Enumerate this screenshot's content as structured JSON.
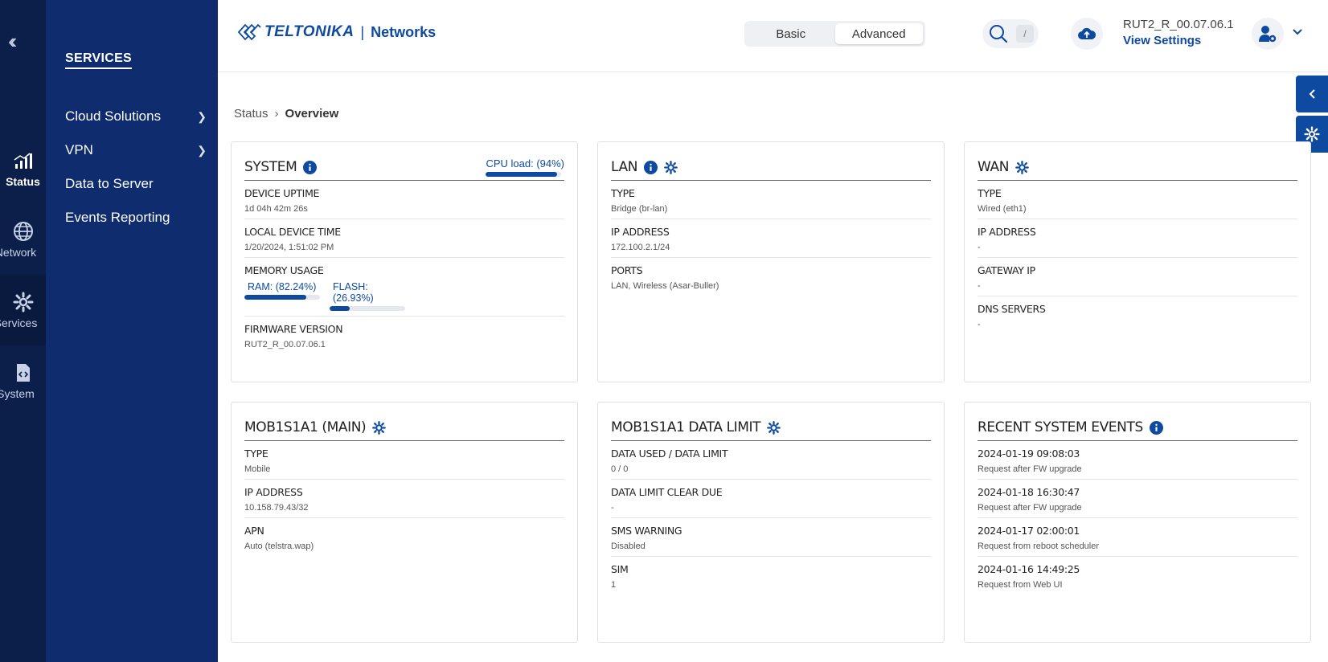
{
  "rail": {
    "items": [
      {
        "label": "Status",
        "icon": "signal-bars-icon"
      },
      {
        "label": "Network",
        "icon": "globe-icon"
      },
      {
        "label": "Services",
        "icon": "gear-icon"
      },
      {
        "label": "System",
        "icon": "file-code-icon"
      }
    ]
  },
  "subnav": {
    "title": "SERVICES",
    "items": [
      {
        "label": "Cloud Solutions",
        "has_children": true
      },
      {
        "label": "VPN",
        "has_children": true
      },
      {
        "label": "Data to Server",
        "has_children": false
      },
      {
        "label": "Events Reporting",
        "has_children": false
      }
    ]
  },
  "header": {
    "brand": "TELTONIKA",
    "brand_suffix": "Networks",
    "mode_basic": "Basic",
    "mode_advanced": "Advanced",
    "mode_selected": "Advanced",
    "search_shortcut": "/",
    "firmware": "RUT2_R_00.07.06.1",
    "view_settings": "View Settings"
  },
  "breadcrumb": {
    "parent": "Status",
    "current": "Overview"
  },
  "cards": {
    "system": {
      "title": "SYSTEM",
      "cpu_label": "CPU load: (94%)",
      "cpu_value": 0.94,
      "uptime_label": "DEVICE UPTIME",
      "uptime_value": "1d 04h 42m 26s",
      "time_label": "LOCAL DEVICE TIME",
      "time_value": "1/20/2024, 1:51:02 PM",
      "memory_label": "MEMORY USAGE",
      "ram_label": "RAM: (82.24%)",
      "ram_value": 0.8224,
      "flash_label": "FLASH: (26.93%)",
      "flash_value": 0.2693,
      "fw_label": "FIRMWARE VERSION",
      "fw_value": "RUT2_R_00.07.06.1"
    },
    "lan": {
      "title": "LAN",
      "fields": [
        {
          "label": "TYPE",
          "value": "Bridge (br-lan)"
        },
        {
          "label": "IP ADDRESS",
          "value": "172.100.2.1/24"
        },
        {
          "label": "PORTS",
          "value": "LAN, Wireless (Asar-Buller)"
        }
      ]
    },
    "wan": {
      "title": "WAN",
      "fields": [
        {
          "label": "TYPE",
          "value": "Wired (eth1)"
        },
        {
          "label": "IP ADDRESS",
          "value": "-"
        },
        {
          "label": "GATEWAY IP",
          "value": "-"
        },
        {
          "label": "DNS SERVERS",
          "value": "-"
        }
      ]
    },
    "mobile": {
      "title": "MOB1S1A1 (MAIN)",
      "fields": [
        {
          "label": "TYPE",
          "value": "Mobile"
        },
        {
          "label": "IP ADDRESS",
          "value": "10.158.79.43/32"
        },
        {
          "label": "APN",
          "value": "Auto (telstra.wap)"
        }
      ]
    },
    "data_limit": {
      "title": "MOB1S1A1 DATA LIMIT",
      "fields": [
        {
          "label": "DATA USED / DATA LIMIT",
          "value": "0 / 0"
        },
        {
          "label": "DATA LIMIT CLEAR DUE",
          "value": "-"
        },
        {
          "label": "SMS WARNING",
          "value": "Disabled"
        },
        {
          "label": "SIM",
          "value": "1"
        }
      ]
    },
    "events": {
      "title": "RECENT SYSTEM EVENTS",
      "fields": [
        {
          "label": "2024-01-19 09:08:03",
          "value": "Request after FW upgrade"
        },
        {
          "label": "2024-01-18 16:30:47",
          "value": "Request after FW upgrade"
        },
        {
          "label": "2024-01-17 02:00:01",
          "value": "Request from reboot scheduler"
        },
        {
          "label": "2024-01-16 14:49:25",
          "value": "Request from Web UI"
        }
      ]
    }
  },
  "colors": {
    "primary": "#0e4aa0",
    "rail": "#0c1f4a",
    "subnav": "#0e2c6e"
  }
}
